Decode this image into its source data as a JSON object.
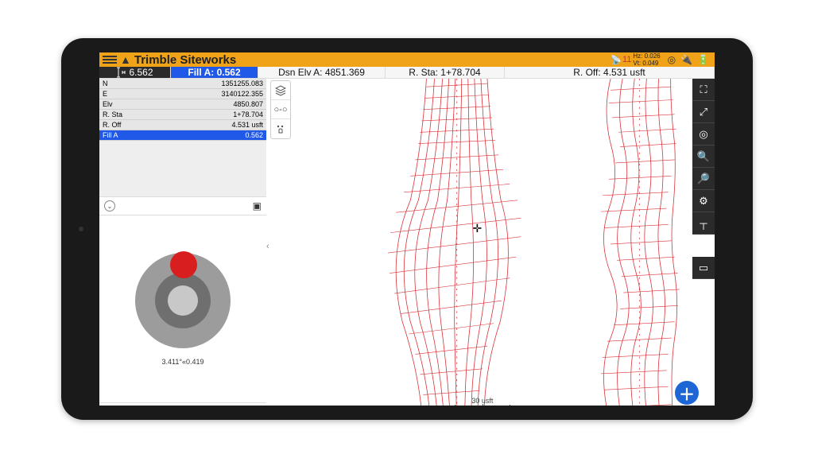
{
  "header": {
    "title": "Trimble Siteworks",
    "gnss_sats": "11",
    "hz": "Hz: 0.026",
    "vt": "Vt: 0.049"
  },
  "infobar": {
    "height_value": "6.562",
    "fill_a": "Fill A: 0.562",
    "dsn_elv": "Dsn Elv A: 4851.369",
    "r_sta": "R. Sta: 1+78.704",
    "r_off": "R. Off: 4.531 usft"
  },
  "data_rows": [
    {
      "k": "N",
      "v": "1351255.083"
    },
    {
      "k": "E",
      "v": "3140122.355"
    },
    {
      "k": "Elv",
      "v": "4850.807"
    },
    {
      "k": "R. Sta",
      "v": "1+78.704"
    },
    {
      "k": "R. Off",
      "v": "4.531 usft"
    },
    {
      "k": "Fill A",
      "v": "0.562"
    }
  ],
  "bullseye": {
    "reading": "3.411°«0.419"
  },
  "scale": {
    "label": "30 usft"
  },
  "tools": {
    "mini": [
      "layers-icon",
      "link-icon",
      "options-icon"
    ],
    "right": [
      "crop-icon",
      "fullscreen-icon",
      "target-icon",
      "zoom-in-icon",
      "zoom-out-icon",
      "settings-icon",
      "prism-icon",
      "offset-icon"
    ]
  }
}
